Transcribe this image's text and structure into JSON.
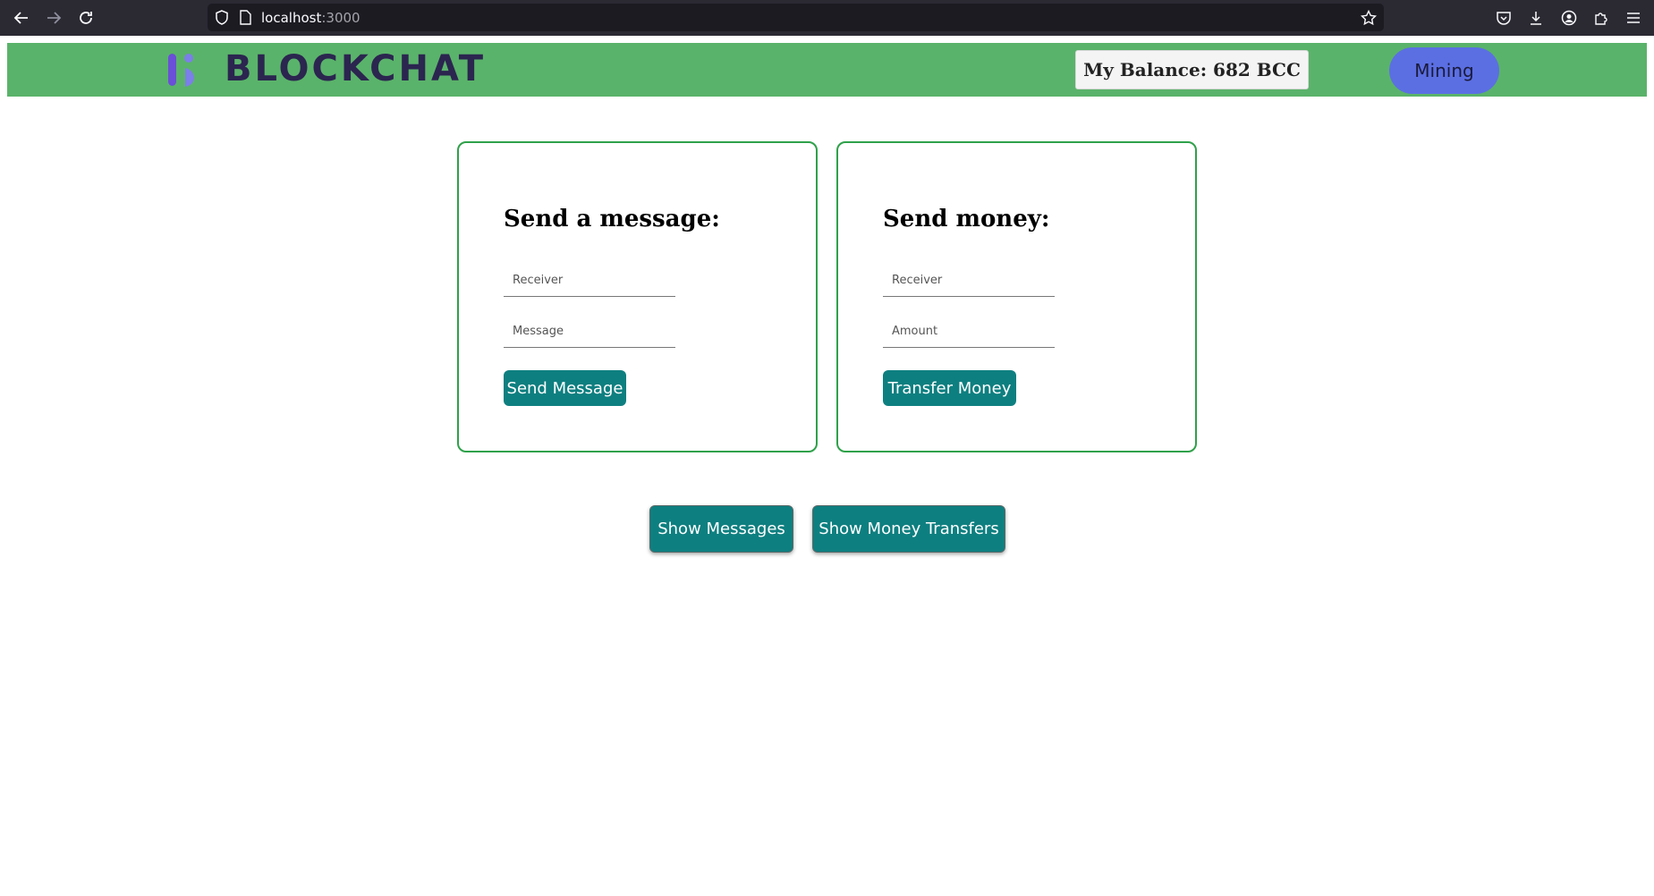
{
  "browser": {
    "url_host": "localhost",
    "url_port": ":3000",
    "icons": [
      "back-icon",
      "forward-icon",
      "reload-icon",
      "shield-icon",
      "page-icon",
      "bookmark-star-icon",
      "pocket-icon",
      "download-icon",
      "account-icon",
      "extensions-icon",
      "menu-icon"
    ]
  },
  "header": {
    "logo_text": "BLOCKCHAT",
    "balance": "My Balance: 682 BCC",
    "mining_label": "Mining",
    "colors": {
      "bar": "#5ab36a",
      "mining": "#5b6fe3"
    }
  },
  "message_card": {
    "title": "Send a message:",
    "receiver_placeholder": "Receiver",
    "message_placeholder": "Message",
    "button_label": "Send Message"
  },
  "money_card": {
    "title": "Send money:",
    "receiver_placeholder": "Receiver",
    "amount_placeholder": "Amount",
    "button_label": "Transfer Money"
  },
  "actions": {
    "show_messages": "Show Messages",
    "show_transfers": "Show Money Transfers",
    "accent_color": "#0e7f80"
  }
}
